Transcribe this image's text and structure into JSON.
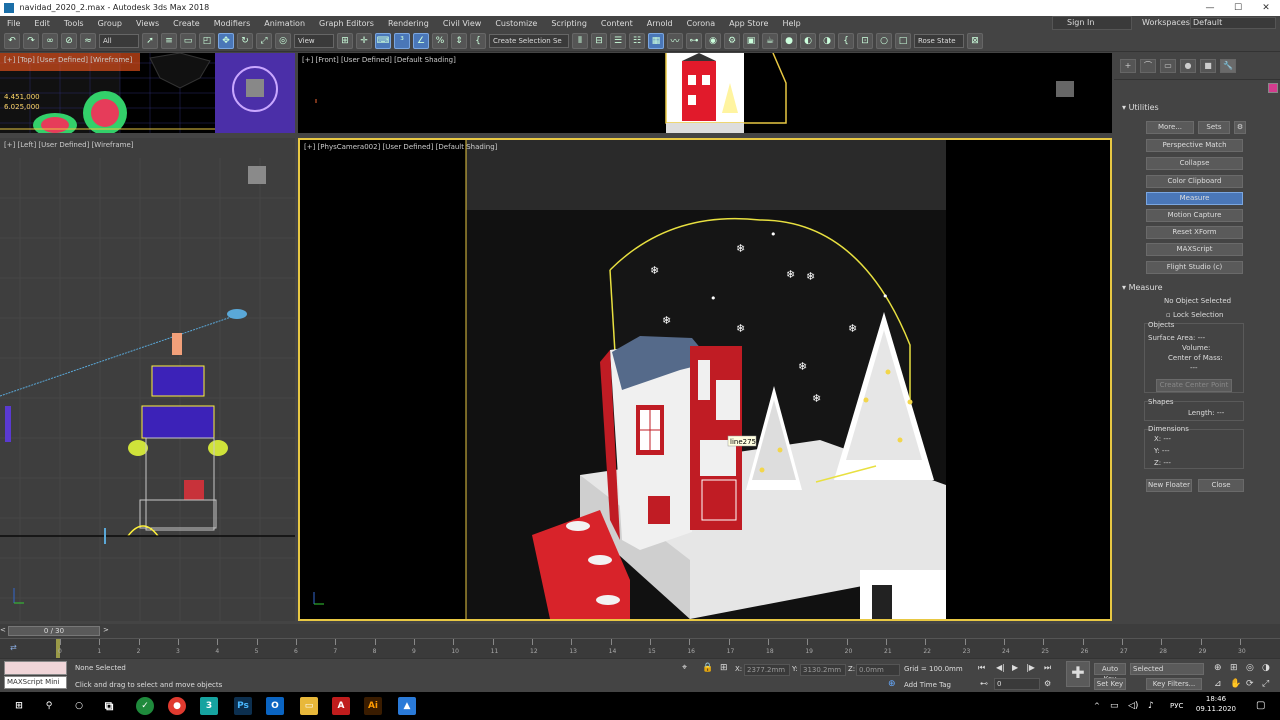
{
  "window": {
    "title": "navidad_2020_2.max - Autodesk 3ds Max 2018",
    "controls": [
      "—",
      "☐",
      "✕"
    ]
  },
  "menu": {
    "items": [
      "File",
      "Edit",
      "Tools",
      "Group",
      "Views",
      "Create",
      "Modifiers",
      "Animation",
      "Graph Editors",
      "Rendering",
      "Civil View",
      "Customize",
      "Scripting",
      "Content",
      "Arnold",
      "Corona",
      "App Store",
      "Help"
    ],
    "signin_label": "Sign In",
    "workspace_label": "Workspaces:",
    "workspace_value": "Default"
  },
  "toolbar": {
    "filter_value": "All",
    "view_value": "View",
    "selection_set_value": "Create Selection Se",
    "snap_value": "Rose State"
  },
  "viewports": {
    "top_label": "[+] [Top] [User Defined] [Wireframe]",
    "top_readout": [
      "4.451,000",
      "6.025,000"
    ],
    "front_label": "[+] [Front] [User Defined] [Default Shading]",
    "left_label": "[+] [Left] [User Defined] [Wireframe]",
    "persp_label": "[+] [PhysCamera002] [User Defined] [Default Shading]",
    "tooltip": "line275"
  },
  "command_panel": {
    "tabs": [
      "+",
      "⌒",
      "▭",
      "●",
      "■",
      "🔧"
    ],
    "color": "#d43c8e",
    "utilities_title": "Utilities",
    "more_label": "More...",
    "sets_label": "Sets",
    "utility_buttons": [
      "Perspective Match",
      "Collapse",
      "Color Clipboard",
      "Measure",
      "Motion Capture",
      "Reset XForm",
      "MAXScript",
      "Flight Studio (c)"
    ],
    "selected_utility": "Measure",
    "measure_title": "Measure",
    "no_object": "No Object Selected",
    "lock_selection": "Lock Selection",
    "objects_title": "Objects",
    "surface_area": "Surface Area: ---",
    "volume": "Volume:",
    "center_of_mass": "Center of Mass:",
    "com_value": "---",
    "create_center_point": "Create Center Point",
    "shapes_title": "Shapes",
    "length": "Length: ---",
    "dimensions_title": "Dimensions",
    "dim_x": "X: ---",
    "dim_y": "Y: ---",
    "dim_z": "Z: ---",
    "new_floater": "New Floater",
    "close": "Close"
  },
  "timeline": {
    "frame_counter": "0 / 30",
    "tick_labels": [
      "0",
      "1",
      "2",
      "3",
      "4",
      "5",
      "6",
      "7",
      "8",
      "9",
      "10",
      "11",
      "12",
      "13",
      "14",
      "15",
      "16",
      "17",
      "18",
      "19",
      "20",
      "21",
      "22",
      "23",
      "24",
      "25",
      "26",
      "27",
      "28",
      "29",
      "30"
    ]
  },
  "status": {
    "maxscript_label": "MAXScript Mini",
    "selection_status": "None Selected",
    "prompt": "Click and drag to select and move objects",
    "x_label": "X:",
    "x_value": "2377.2mm",
    "y_label": "Y:",
    "y_value": "3130.2mm",
    "z_label": "Z:",
    "z_value": "0.0mm",
    "grid": "Grid = 100.0mm",
    "add_time_tag": "Add Time Tag",
    "frame_value": "0",
    "auto_key": "Auto Key",
    "set_key": "Set Key",
    "selected_dropdown": "Selected",
    "key_filters": "Key Filters..."
  },
  "taskbar": {
    "time": "18:46",
    "date": "09.11.2020",
    "lang": "РУС"
  }
}
